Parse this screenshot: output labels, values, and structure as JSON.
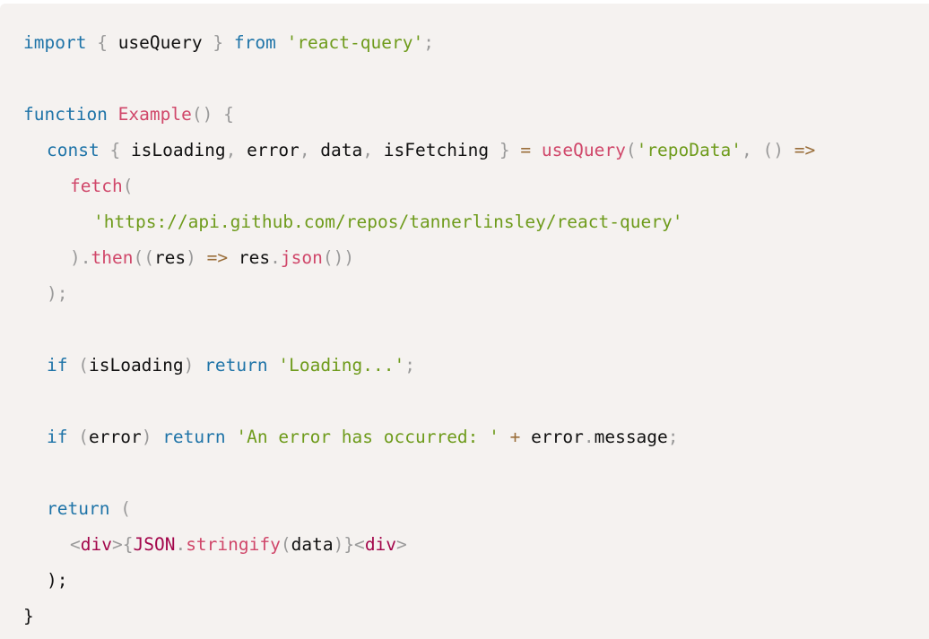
{
  "editor": {
    "language": "javascript",
    "colors": {
      "background": "#f5f2f0",
      "keyword": "#1f74a8",
      "punctuation": "#9a9a9a",
      "string": "#6e9b1b",
      "function": "#d0476a",
      "operator": "#9a6e3a",
      "tag": "#a3064b",
      "text": "#111111"
    },
    "lines": [
      {
        "indent": 0,
        "tokens": [
          {
            "t": "keyword",
            "v": "import"
          },
          {
            "t": "plain",
            "v": " "
          },
          {
            "t": "punct",
            "v": "{"
          },
          {
            "t": "plain",
            "v": " useQuery "
          },
          {
            "t": "punct",
            "v": "}"
          },
          {
            "t": "plain",
            "v": " "
          },
          {
            "t": "keyword",
            "v": "from"
          },
          {
            "t": "plain",
            "v": " "
          },
          {
            "t": "string",
            "v": "'react-query'"
          },
          {
            "t": "punct",
            "v": ";"
          }
        ]
      },
      {
        "indent": 0,
        "tokens": []
      },
      {
        "indent": 0,
        "tokens": [
          {
            "t": "keyword",
            "v": "function"
          },
          {
            "t": "plain",
            "v": " "
          },
          {
            "t": "func",
            "v": "Example"
          },
          {
            "t": "punct",
            "v": "()"
          },
          {
            "t": "plain",
            "v": " "
          },
          {
            "t": "punct",
            "v": "{"
          }
        ]
      },
      {
        "indent": 1,
        "tokens": [
          {
            "t": "keyword",
            "v": "const"
          },
          {
            "t": "plain",
            "v": " "
          },
          {
            "t": "punct",
            "v": "{"
          },
          {
            "t": "plain",
            "v": " isLoading"
          },
          {
            "t": "punct",
            "v": ","
          },
          {
            "t": "plain",
            "v": " error"
          },
          {
            "t": "punct",
            "v": ","
          },
          {
            "t": "plain",
            "v": " data"
          },
          {
            "t": "punct",
            "v": ","
          },
          {
            "t": "plain",
            "v": " isFetching "
          },
          {
            "t": "punct",
            "v": "}"
          },
          {
            "t": "plain",
            "v": " "
          },
          {
            "t": "op",
            "v": "="
          },
          {
            "t": "plain",
            "v": " "
          },
          {
            "t": "func",
            "v": "useQuery"
          },
          {
            "t": "punct",
            "v": "("
          },
          {
            "t": "string",
            "v": "'repoData'"
          },
          {
            "t": "punct",
            "v": ","
          },
          {
            "t": "plain",
            "v": " "
          },
          {
            "t": "punct",
            "v": "()"
          },
          {
            "t": "plain",
            "v": " "
          },
          {
            "t": "op",
            "v": "=>"
          }
        ]
      },
      {
        "indent": 2,
        "tokens": [
          {
            "t": "func",
            "v": "fetch"
          },
          {
            "t": "punct",
            "v": "("
          }
        ]
      },
      {
        "indent": 3,
        "tokens": [
          {
            "t": "string",
            "v": "'https://api.github.com/repos/tannerlinsley/react-query'"
          }
        ]
      },
      {
        "indent": 2,
        "tokens": [
          {
            "t": "punct",
            "v": ")."
          },
          {
            "t": "func",
            "v": "then"
          },
          {
            "t": "punct",
            "v": "(("
          },
          {
            "t": "plain",
            "v": "res"
          },
          {
            "t": "punct",
            "v": ")"
          },
          {
            "t": "plain",
            "v": " "
          },
          {
            "t": "op",
            "v": "=>"
          },
          {
            "t": "plain",
            "v": " res"
          },
          {
            "t": "punct",
            "v": "."
          },
          {
            "t": "func",
            "v": "json"
          },
          {
            "t": "punct",
            "v": "())"
          }
        ]
      },
      {
        "indent": 1,
        "tokens": [
          {
            "t": "punct",
            "v": ");"
          }
        ]
      },
      {
        "indent": 0,
        "tokens": []
      },
      {
        "indent": 1,
        "tokens": [
          {
            "t": "keyword",
            "v": "if"
          },
          {
            "t": "plain",
            "v": " "
          },
          {
            "t": "punct",
            "v": "("
          },
          {
            "t": "plain",
            "v": "isLoading"
          },
          {
            "t": "punct",
            "v": ")"
          },
          {
            "t": "plain",
            "v": " "
          },
          {
            "t": "keyword",
            "v": "return"
          },
          {
            "t": "plain",
            "v": " "
          },
          {
            "t": "string",
            "v": "'Loading...'"
          },
          {
            "t": "punct",
            "v": ";"
          }
        ]
      },
      {
        "indent": 0,
        "tokens": []
      },
      {
        "indent": 1,
        "tokens": [
          {
            "t": "keyword",
            "v": "if"
          },
          {
            "t": "plain",
            "v": " "
          },
          {
            "t": "punct",
            "v": "("
          },
          {
            "t": "plain",
            "v": "error"
          },
          {
            "t": "punct",
            "v": ")"
          },
          {
            "t": "plain",
            "v": " "
          },
          {
            "t": "keyword",
            "v": "return"
          },
          {
            "t": "plain",
            "v": " "
          },
          {
            "t": "string",
            "v": "'An error has occurred: '"
          },
          {
            "t": "plain",
            "v": " "
          },
          {
            "t": "op",
            "v": "+"
          },
          {
            "t": "plain",
            "v": " error"
          },
          {
            "t": "punct",
            "v": "."
          },
          {
            "t": "plain",
            "v": "message"
          },
          {
            "t": "punct",
            "v": ";"
          }
        ]
      },
      {
        "indent": 0,
        "tokens": []
      },
      {
        "indent": 1,
        "tokens": [
          {
            "t": "keyword",
            "v": "return"
          },
          {
            "t": "plain",
            "v": " "
          },
          {
            "t": "punct",
            "v": "("
          }
        ]
      },
      {
        "indent": 2,
        "tokens": [
          {
            "t": "punct",
            "v": "<"
          },
          {
            "t": "tag",
            "v": "div"
          },
          {
            "t": "punct",
            "v": ">{"
          },
          {
            "t": "tag",
            "v": "JSON"
          },
          {
            "t": "punct",
            "v": "."
          },
          {
            "t": "func",
            "v": "stringify"
          },
          {
            "t": "punct",
            "v": "("
          },
          {
            "t": "plain",
            "v": "data"
          },
          {
            "t": "punct",
            "v": ")}<"
          },
          {
            "t": "tag",
            "v": "div"
          },
          {
            "t": "punct",
            "v": ">"
          }
        ]
      },
      {
        "indent": 1,
        "tokens": [
          {
            "t": "plain",
            "v": ");"
          }
        ]
      },
      {
        "indent": 0,
        "tokens": [
          {
            "t": "plain",
            "v": "}"
          }
        ]
      }
    ]
  }
}
